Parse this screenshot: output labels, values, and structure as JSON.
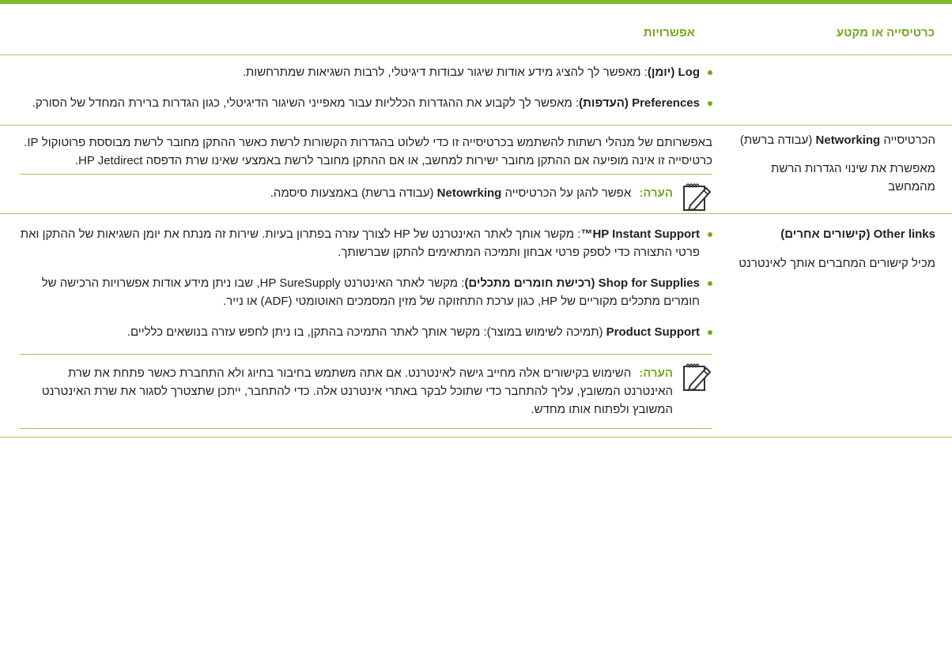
{
  "header": {
    "col_section": "כרטיסייה או מקטע",
    "col_options": "אפשרויות"
  },
  "rows": [
    {
      "options": [
        {
          "bold": "Log (יומן)",
          "rest": ": מאפשר לך להציג מידע אודות שיגור עבודות דיגיטלי, לרבות השגיאות שמתרחשות."
        },
        {
          "bold": "Preferences (העדפות)",
          "rest": ": מאפשר לך לקבוע את ההגדרות הכלליות עבור מאפייני השיגור הדיגיטלי, כגון הגדרות ברירת המחדל של הסורק."
        }
      ]
    },
    {
      "section_pre": "הכרטיסייה ",
      "section_bold": "Networking",
      "section_post": " (עבודה ברשת)",
      "section_desc": "מאפשרת את שינוי הגדרות הרשת מהמחשב",
      "text": "באפשרותם של מנהלי רשתות להשתמש בכרטיסייה זו כדי לשלוט בהגדרות הקשורות לרשת כאשר ההתקן מחובר לרשת מבוססת פרוטוקול IP. כרטיסייה זו אינה מופיעה אם ההתקן מחובר ישירות למחשב, או אם ההתקן מחובר לרשת באמצעי שאינו שרת הדפסה HP Jetdirect.",
      "note": {
        "label": "הערה:",
        "pre": "אפשר להגן על הכרטיסייה ",
        "bold": "Netowrking",
        "post": " (עבודה ברשת) באמצעות סיסמה."
      }
    },
    {
      "section_bold": "Other links (קישורים אחרים)",
      "section_desc": "מכיל קישורים המחברים אותך לאינטרנט",
      "options": [
        {
          "bold": "HP Instant Support™",
          "rest": ": מקשר אותך לאתר האינטרנט של HP לצורך עזרה בפתרון בעיות. שירות זה מנתח את יומן השגיאות של ההתקן ואת פרטי התצורה כדי לספק פרטי אבחון ותמיכה המתאימים להתקן שברשותך."
        },
        {
          "bold": "Shop for Supplies (רכישת חומרים מתכלים)",
          "rest": ": מקשר לאתר האינטרנט HP SureSupply, שבו ניתן מידע אודות אפשרויות הרכישה של חומרים מתכלים מקוריים של HP, כגון ערכת התחזוקה של מזין המסמכים האוטומטי (ADF) או נייר."
        },
        {
          "bold": "Product Support",
          "rest": " (תמיכה לשימוש במוצר): מקשר אותך לאתר התמיכה בהתקן, בו ניתן לחפש עזרה בנושאים כלליים."
        }
      ],
      "note": {
        "label": "הערה:",
        "text": "השימוש בקישורים אלה מחייב גישה לאינטרנט. אם אתה משתמש בחיבור בחיוג ולא התחברת כאשר פתחת את שרת האינטרנט המשובץ, עליך להתחבר כדי שתוכל לבקר באתרי אינטרנט אלה. כדי להתחבר, ייתכן שתצטרך לסגור את שרת האינטרנט המשובץ ולפתוח אותו מחדש."
      }
    }
  ]
}
